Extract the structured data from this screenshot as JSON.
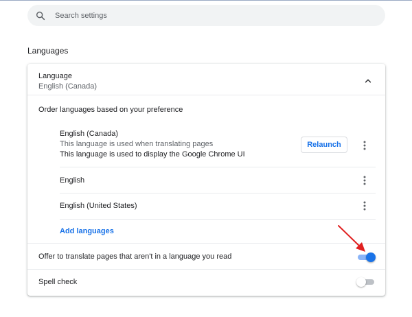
{
  "search": {
    "placeholder": "Search settings",
    "icon": "search-icon"
  },
  "section": {
    "title": "Languages"
  },
  "language_card": {
    "header_label": "Language",
    "current_language": "English (Canada)",
    "collapse_icon": "chevron-up-icon",
    "order_title": "Order languages based on your preference",
    "languages": [
      {
        "name": "English (Canada)",
        "note_translate": "This language is used when translating pages",
        "note_ui": "This language is used to display the Google Chrome UI",
        "action_label": "Relaunch"
      },
      {
        "name": "English"
      },
      {
        "name": "English (United States)"
      }
    ],
    "more_icon": "more-vert-icon",
    "add_languages_label": "Add languages",
    "offer_translate": {
      "label": "Offer to translate pages that aren't in a language you read",
      "enabled": true
    },
    "spell_check": {
      "label": "Spell check",
      "enabled": false
    }
  },
  "annotation": {
    "icon": "arrow-icon",
    "color": "#e02020"
  },
  "colors": {
    "accent": "#1a73e8",
    "text": "#202124",
    "secondary_text": "#5f6368"
  }
}
